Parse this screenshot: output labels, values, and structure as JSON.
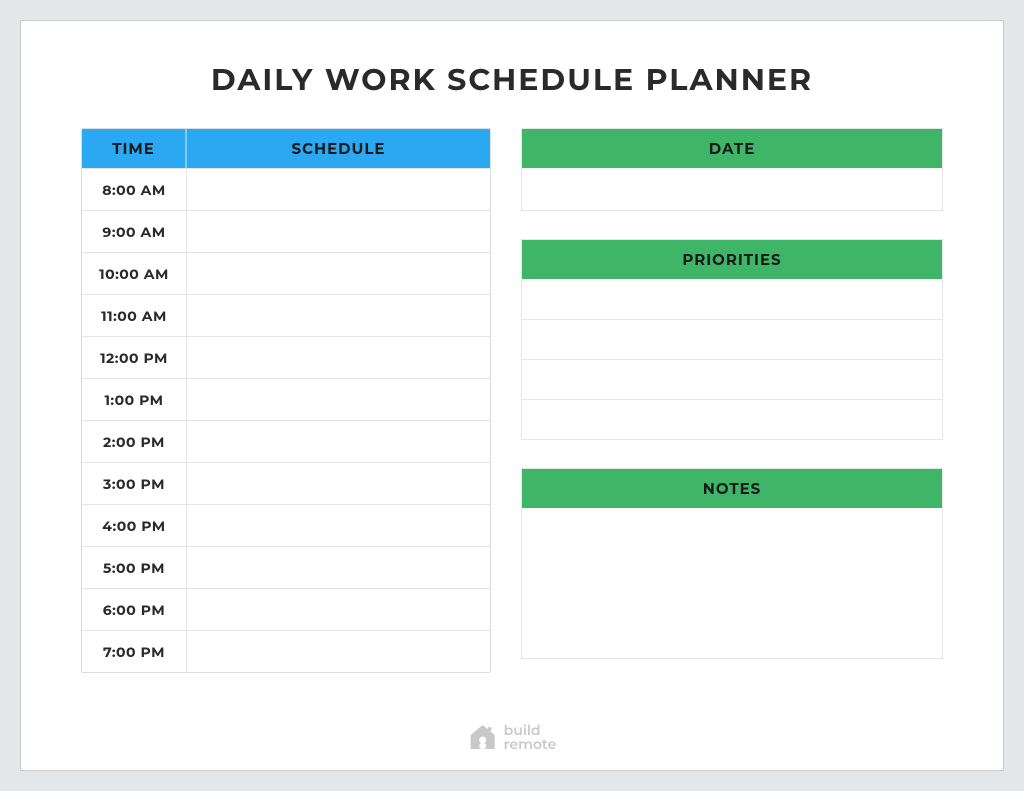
{
  "title": "DAILY WORK SCHEDULE PLANNER",
  "schedule": {
    "headers": {
      "time": "TIME",
      "schedule": "SCHEDULE"
    },
    "rows": [
      {
        "time": "8:00 AM"
      },
      {
        "time": "9:00 AM"
      },
      {
        "time": "10:00 AM"
      },
      {
        "time": "11:00 AM"
      },
      {
        "time": "12:00 PM"
      },
      {
        "time": "1:00 PM"
      },
      {
        "time": "2:00 PM"
      },
      {
        "time": "3:00 PM"
      },
      {
        "time": "4:00 PM"
      },
      {
        "time": "5:00 PM"
      },
      {
        "time": "6:00 PM"
      },
      {
        "time": "7:00 PM"
      }
    ]
  },
  "date": {
    "header": "DATE"
  },
  "priorities": {
    "header": "PRIORITIES",
    "row_count": 4
  },
  "notes": {
    "header": "NOTES"
  },
  "logo": {
    "line1": "build",
    "line2": "remote"
  }
}
